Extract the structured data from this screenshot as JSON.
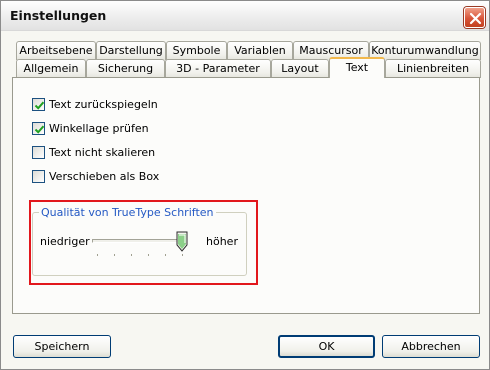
{
  "window": {
    "title": "Einstellungen"
  },
  "tabs_row_back": [
    {
      "label": "Arbeitsebene"
    },
    {
      "label": "Darstellung"
    },
    {
      "label": "Symbole"
    },
    {
      "label": "Variablen"
    },
    {
      "label": "Mauscursor"
    },
    {
      "label": "Konturumwandlung"
    }
  ],
  "tabs_row_front": [
    {
      "label": "Allgemein"
    },
    {
      "label": "Sicherung"
    },
    {
      "label": "3D - Parameter"
    },
    {
      "label": "Layout"
    },
    {
      "label": "Text",
      "active": true
    },
    {
      "label": "Linienbreiten"
    }
  ],
  "options": [
    {
      "label": "Text zurückspiegeln",
      "checked": true
    },
    {
      "label": "Winkellage prüfen",
      "checked": true
    },
    {
      "label": "Text nicht skalieren",
      "checked": false
    },
    {
      "label": "Verschieben als Box",
      "checked": false
    }
  ],
  "truetype_group": {
    "title": "Qualität von TrueType Schriften",
    "low_label": "niedriger",
    "high_label": "höher",
    "slider_level": 1.0,
    "tick_count": 6
  },
  "buttons": {
    "save": "Speichern",
    "ok": "OK",
    "cancel": "Abbrechen"
  },
  "icons": {
    "close": "close-icon",
    "check": "checkmark-icon",
    "slider_thumb": "slider-thumb-icon"
  },
  "colors": {
    "highlight_box": "#e2171c",
    "active_tab_accent": "#f2b84b",
    "group_title": "#2459c4",
    "close_button": "#d8553a",
    "checkbox_check": "#21a121"
  }
}
